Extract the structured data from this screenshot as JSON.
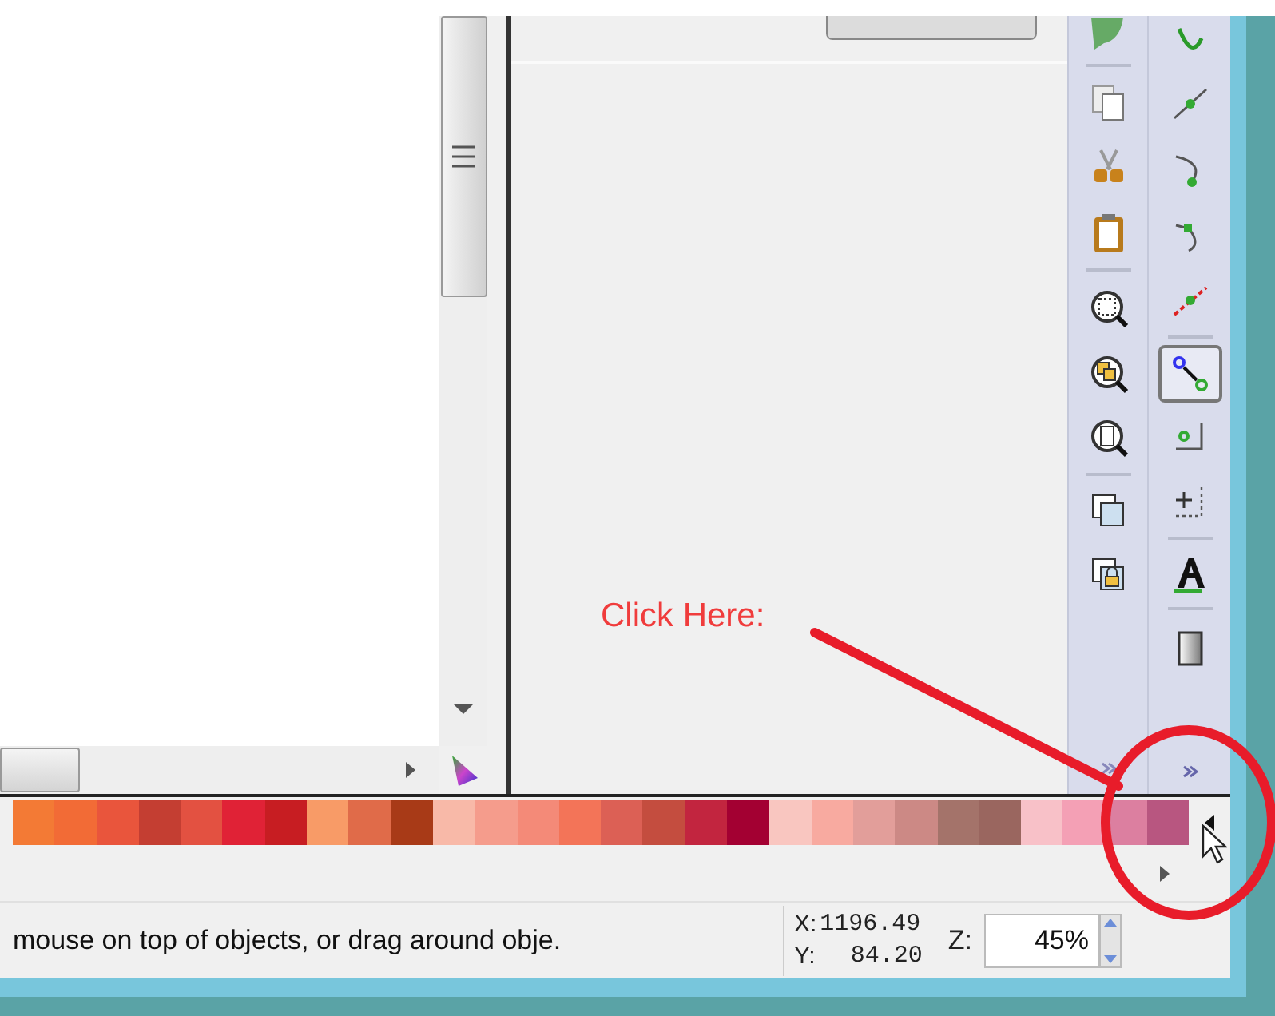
{
  "tool_bar": {
    "tools": [
      {
        "selected": false
      },
      {
        "selected": false
      },
      {
        "selected": false
      },
      {
        "selected": false
      },
      {
        "selected": false
      },
      {
        "selected": true
      },
      {
        "selected": false
      },
      {
        "selected": false
      },
      {
        "selected": false
      },
      {
        "selected": false
      }
    ]
  },
  "palette": [
    {
      "color": "#f37a35"
    },
    {
      "color": "#f26b36"
    },
    {
      "color": "#e9553c"
    },
    {
      "color": "#c43e32"
    },
    {
      "color": "#e35141"
    },
    {
      "color": "#e02236"
    },
    {
      "color": "#c71d22"
    },
    {
      "color": "#f89b67"
    },
    {
      "color": "#e06b49"
    },
    {
      "color": "#a83a17"
    },
    {
      "color": "#f8b9a8"
    },
    {
      "color": "#f59c8c"
    },
    {
      "color": "#f48a78"
    },
    {
      "color": "#f37458"
    },
    {
      "color": "#dc6055"
    },
    {
      "color": "#c44d3f"
    },
    {
      "color": "#c2253f"
    },
    {
      "color": "#a30032"
    },
    {
      "color": "#f9c6c0"
    },
    {
      "color": "#f8aaa0"
    },
    {
      "color": "#e29e9a"
    },
    {
      "color": "#cc8985"
    },
    {
      "color": "#a4736a"
    },
    {
      "color": "#9a665f"
    },
    {
      "color": "#f8c1c8"
    },
    {
      "color": "#f4a0b5"
    },
    {
      "color": "#dc7fa0"
    },
    {
      "color": "#b85680"
    }
  ],
  "status_bar": {
    "message": "mouse on top of objects, or drag around obje.",
    "x_label": "X:",
    "x_value": "1196.49",
    "y_label": "Y:",
    "y_value": "84.20",
    "zoom_label": "Z:",
    "zoom_value": "45%"
  },
  "annotation": {
    "text": "Click Here:"
  }
}
